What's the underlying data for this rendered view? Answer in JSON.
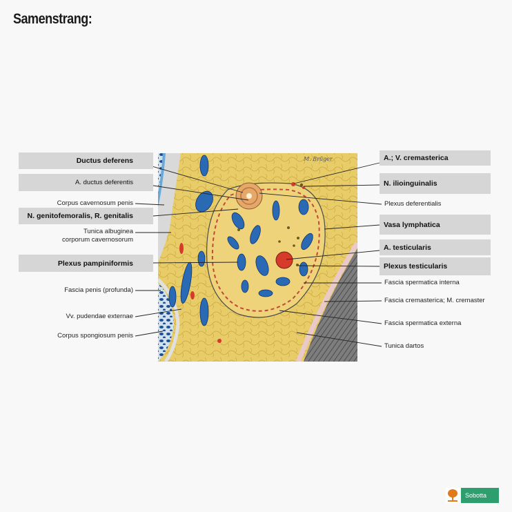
{
  "page_title": "Samenstrang:",
  "signature": "M. Brüger",
  "left_labels": {
    "ductus_deferens": "Ductus deferens",
    "a_ductus_deferentis": "A. ductus deferentis",
    "corpus_cavernosum_penis": "Corpus cavernosum penis",
    "n_genitofemoralis": "N. genitofemoralis, R. genitalis",
    "tunica_albuginea_line1": "Tunica albuginea",
    "tunica_albuginea_line2": "corporum cavernosorum",
    "plexus_pampiniformis": "Plexus pampiniformis",
    "fascia_penis_profunda": "Fascia penis (profunda)",
    "vv_pudendae_externae": "Vv. pudendae externae",
    "corpus_spongiosum_penis": "Corpus spongiosum penis"
  },
  "right_labels": {
    "a_v_cremasterica": "A.; V. cremasterica",
    "n_ilioinguinalis": "N. ilioinguinalis",
    "plexus_deferentialis": "Plexus deferentialis",
    "vasa_lymphatica": "Vasa lymphatica",
    "a_testicularis": "A. testicularis",
    "plexus_testicularis": "Plexus testicularis",
    "fascia_spermatica_interna": "Fascia spermatica interna",
    "fascia_cremasterica": "Fascia cremasterica; M. cremaster",
    "fascia_spermatica_externa": "Fascia spermatica externa",
    "tunica_dartos": "Tunica dartos"
  },
  "brand": {
    "publisher_icon": "elsevier-tree-logo",
    "name": "Sobotta",
    "color": "#2e9e6f"
  },
  "colors": {
    "fat": "#e6c964",
    "vein": "#2a6ab4",
    "artery": "#d63a2a",
    "label_box": "#d6d6d6"
  }
}
